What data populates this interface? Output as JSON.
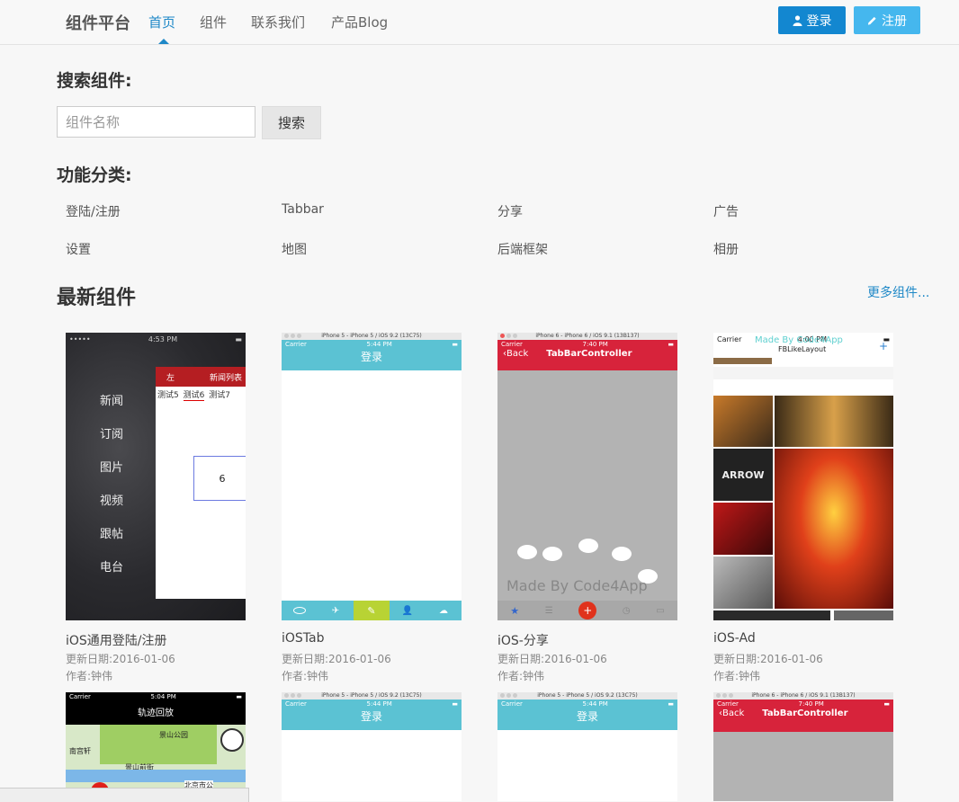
{
  "nav": {
    "brand": "组件平台",
    "items": [
      "首页",
      "组件",
      "联系我们",
      "产品Blog"
    ],
    "login_label": "登录",
    "register_label": "注册"
  },
  "search": {
    "heading": "搜索组件:",
    "placeholder": "组件名称",
    "button_label": "搜索"
  },
  "categories": {
    "heading": "功能分类:",
    "items": [
      "登陆/注册",
      "Tabbar",
      "分享",
      "广告",
      "设置",
      "地图",
      "后端框架",
      "相册"
    ]
  },
  "latest": {
    "heading": "最新组件",
    "more_label": "更多组件...",
    "cards": [
      {
        "title": "iOS通用登陆/注册",
        "date": "更新日期:2016-01-06",
        "author": "作者:钟伟"
      },
      {
        "title": "iOSTab",
        "date": "更新日期:2016-01-06",
        "author": "作者:钟伟"
      },
      {
        "title": "iOS-分享",
        "date": "更新日期:2016-01-06",
        "author": "作者:钟伟"
      },
      {
        "title": "iOS-Ad",
        "date": "更新日期:2016-01-06",
        "author": "作者:钟伟"
      }
    ]
  },
  "screens": {
    "s1": {
      "time": "4:53 PM",
      "menu": [
        "新闻",
        "订阅",
        "图片",
        "视频",
        "跟帖",
        "电台"
      ],
      "left": "左",
      "title": "新闻列表",
      "tabs": [
        "测试5",
        "测试6",
        "测试7"
      ],
      "box": "6"
    },
    "s2": {
      "mac": "iPhone 5 - iPhone 5 / iOS 9.2 (13C75)",
      "carrier": "Carrier",
      "time": "5:44 PM",
      "title": "登录"
    },
    "s3": {
      "mac": "iPhone 6 - iPhone 6 / iOS 9.1 (13B137)",
      "carrier": "Carrier",
      "time": "7:40 PM",
      "back": "Back",
      "title": "TabBarController",
      "watermark": "Made By Code4App"
    },
    "s4": {
      "carrier": "Carrier",
      "time": "4:00 PM",
      "watermark": "Made By Code4App",
      "title": "FBLikeLayout",
      "plus": "+",
      "arrow": "ARROW"
    },
    "s5": {
      "carrier": "Carrier",
      "time": "5:04 PM",
      "title": "轨迹回放",
      "place1": "景山公园",
      "place2": "景山前街",
      "place3": "北京市公",
      "place4": "南宫轩"
    },
    "s6": {
      "mac": "iPhone 5 - iPhone 5 / iOS 9.2 (13C75)",
      "carrier": "Carrier",
      "time": "5:44 PM",
      "title": "登录"
    },
    "s7": {
      "mac": "iPhone 5 - iPhone 5 / iOS 9.2 (13C75)",
      "carrier": "Carrier",
      "time": "5:44 PM",
      "title": "登录"
    },
    "s8": {
      "mac": "iPhone 6 - iPhone 6 / iOS 9.1 (13B137)",
      "carrier": "Carrier",
      "time": "7:40 PM",
      "back": "Back",
      "title": "TabBarController"
    }
  },
  "colors": {
    "accent": "#1e88c7",
    "login_bg": "#1387d0",
    "register_bg": "#45b7ee",
    "teal": "#5bc2d3",
    "red_nav": "#d7233b"
  }
}
